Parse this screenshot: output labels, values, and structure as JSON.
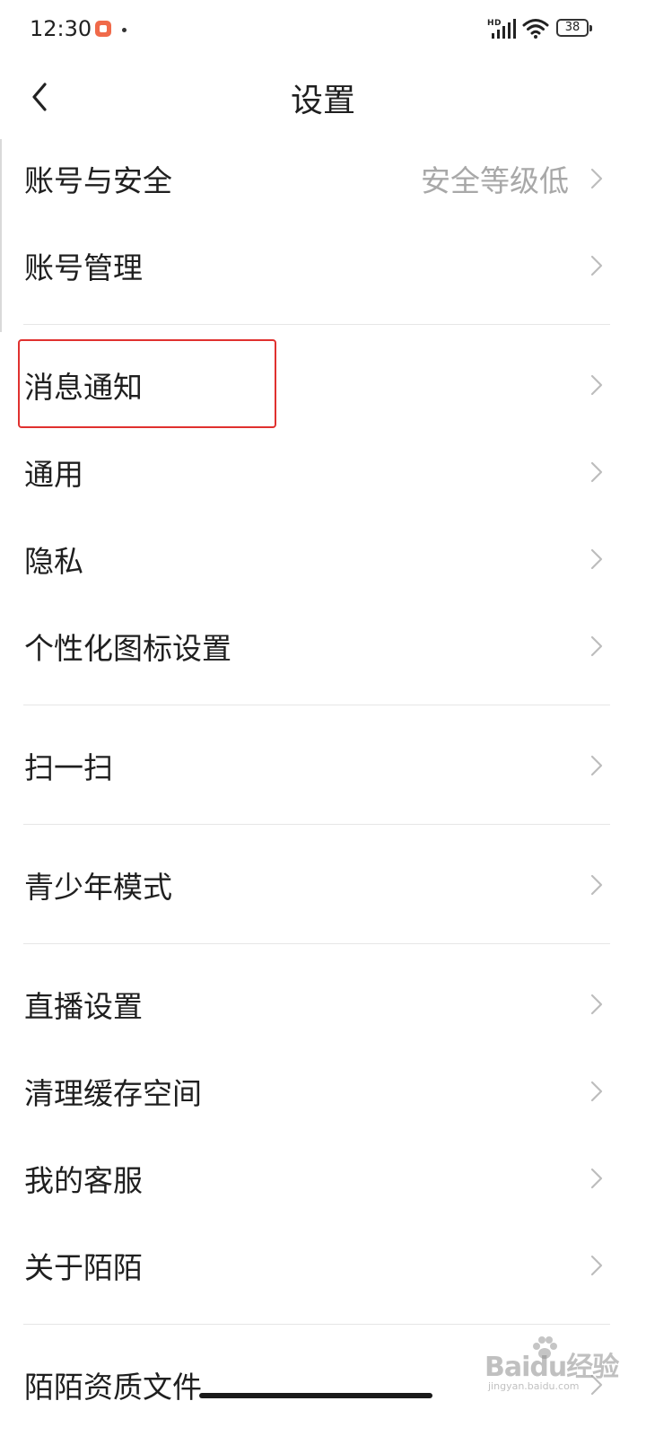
{
  "status_bar": {
    "time": "12:30",
    "network": "HD",
    "battery": "38"
  },
  "nav": {
    "title": "设置"
  },
  "settings": {
    "account_security": {
      "label": "账号与安全",
      "value": "安全等级低"
    },
    "account_manage": {
      "label": "账号管理"
    },
    "notifications": {
      "label": "消息通知"
    },
    "general": {
      "label": "通用"
    },
    "privacy": {
      "label": "隐私"
    },
    "custom_icon": {
      "label": "个性化图标设置"
    },
    "scan": {
      "label": "扫一扫"
    },
    "teen_mode": {
      "label": "青少年模式"
    },
    "live_settings": {
      "label": "直播设置"
    },
    "clear_cache": {
      "label": "清理缓存空间"
    },
    "customer_service": {
      "label": "我的客服"
    },
    "about": {
      "label": "关于陌陌"
    },
    "qualification_docs": {
      "label": "陌陌资质文件"
    }
  },
  "watermark": {
    "logo": "Baidu经验",
    "sub": "jingyan.baidu.com"
  },
  "colors": {
    "highlight": "#e0312f",
    "secondary_text": "#a8a8a8",
    "divider": "#e6e6e6"
  }
}
